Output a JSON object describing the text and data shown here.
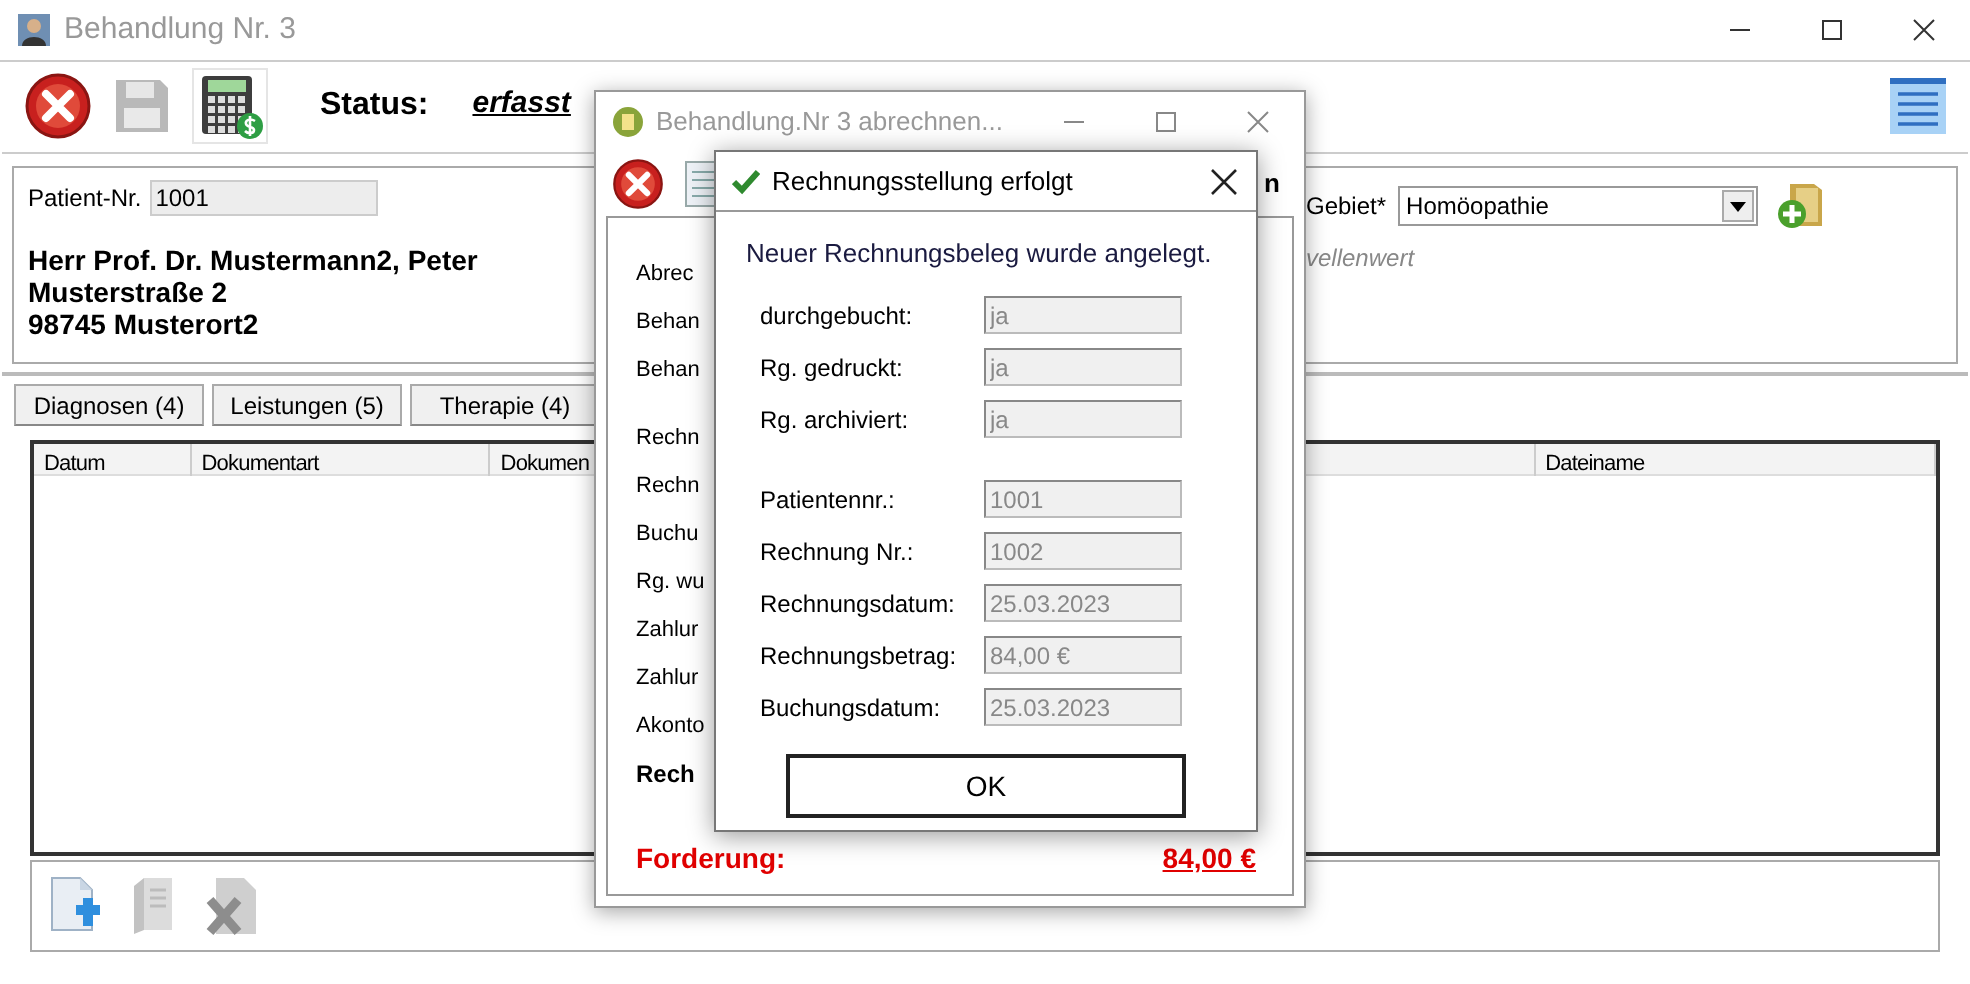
{
  "window": {
    "title": "Behandlung Nr. 3"
  },
  "toolbar": {
    "status_label": "Status:",
    "status_value": "erfasst"
  },
  "patient": {
    "number_label": "Patient-Nr.",
    "number": "1001",
    "address_lines": [
      "Herr Prof. Dr. Mustermann2, Peter",
      "Musterstraße 2",
      "98745 Musterort2"
    ],
    "area_label": "Gebiet*",
    "area": "Homöopathie",
    "hint": "vellenwert"
  },
  "tabs": [
    {
      "label": "Diagnosen (4)"
    },
    {
      "label": "Leistungen (5)"
    },
    {
      "label": "Therapie (4)"
    }
  ],
  "table": {
    "columns": [
      "Datum",
      "Dokumentart",
      "Dokumen",
      "Dateiname"
    ]
  },
  "billing_dialog": {
    "title": "Behandlung.Nr 3 abrechnen...",
    "toolbar_text": "n",
    "labels": [
      {
        "text": "Abrec",
        "kind": "normal"
      },
      {
        "text": "Behan",
        "kind": "normal"
      },
      {
        "text": "Behan",
        "kind": "normal"
      },
      {
        "text": "Rechn",
        "kind": "normal"
      },
      {
        "text": "Rechn",
        "kind": "normal"
      },
      {
        "text": "Buchu",
        "kind": "normal"
      },
      {
        "text": "Rg. wu",
        "kind": "normal"
      },
      {
        "text": "Zahlur",
        "kind": "normal"
      },
      {
        "text": "Zahlur",
        "kind": "normal"
      },
      {
        "text": "Akonto",
        "kind": "normal"
      },
      {
        "text": "Rech",
        "kind": "bold"
      }
    ],
    "total_label": "Forderung:",
    "total": "84,00 €"
  },
  "message_box": {
    "title": "Rechnungsstellung erfolgt",
    "message": "Neuer Rechnungsbeleg wurde angelegt.",
    "groups": [
      [
        {
          "label": "durchgebucht:",
          "value": "ja"
        },
        {
          "label": "Rg. gedruckt:",
          "value": "ja"
        },
        {
          "label": "Rg. archiviert:",
          "value": "ja"
        }
      ],
      [
        {
          "label": "Patientennr.:",
          "value": "1001"
        },
        {
          "label": "Rechnung Nr.:",
          "value": "1002"
        },
        {
          "label": "Rechnungsdatum:",
          "value": "25.03.2023"
        },
        {
          "label": "Rechnungsbetrag:",
          "value": "84,00 €"
        },
        {
          "label": "Buchungsdatum:",
          "value": "25.03.2023"
        }
      ]
    ],
    "button": "OK"
  }
}
